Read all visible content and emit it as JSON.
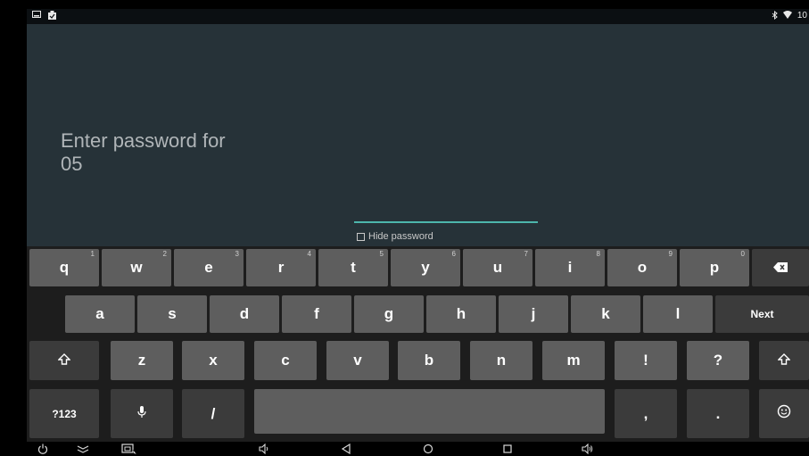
{
  "status_bar": {
    "left_icons": [
      "notification-icon",
      "clipboard-icon"
    ],
    "right_icons": [
      "bluetooth-icon",
      "wifi-icon"
    ],
    "clock_partial": "10"
  },
  "prompt": {
    "line1": "Enter password for",
    "line2": "05"
  },
  "password_field": {
    "value": ""
  },
  "hide_password": {
    "label": "Hide password",
    "checked": false
  },
  "keyboard": {
    "row1": [
      {
        "label": "q",
        "hint": "1"
      },
      {
        "label": "w",
        "hint": "2"
      },
      {
        "label": "e",
        "hint": "3"
      },
      {
        "label": "r",
        "hint": "4"
      },
      {
        "label": "t",
        "hint": "5"
      },
      {
        "label": "y",
        "hint": "6"
      },
      {
        "label": "u",
        "hint": "7"
      },
      {
        "label": "i",
        "hint": "8"
      },
      {
        "label": "o",
        "hint": "9"
      },
      {
        "label": "p",
        "hint": "0"
      }
    ],
    "row2": [
      "a",
      "s",
      "d",
      "f",
      "g",
      "h",
      "j",
      "k",
      "l"
    ],
    "next_label": "Next",
    "row3": [
      "z",
      "x",
      "c",
      "v",
      "b",
      "n",
      "m",
      "!",
      "?"
    ],
    "symbols_label": "?123",
    "slash_label": "/",
    "comma_label": ",",
    "period_label": ".",
    "icons": {
      "backspace": "backspace-icon",
      "shift": "shift-icon",
      "mic": "mic-icon",
      "emoji": "emoji-icon"
    }
  },
  "nav_bar": {
    "icons": [
      "power-icon",
      "collapse-icon",
      "screenshot-icon",
      "volume-down-icon",
      "back-icon",
      "home-icon",
      "recents-icon",
      "volume-up-icon"
    ]
  }
}
